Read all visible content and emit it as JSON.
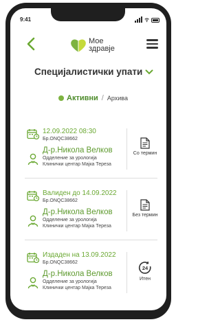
{
  "status_bar": {
    "time": "9:41"
  },
  "header": {
    "logo_line1": "Мое",
    "logo_line2": "здравје"
  },
  "page": {
    "title": "Специјалистички упати"
  },
  "filter": {
    "active": "Активни",
    "separator": "/",
    "archive": "Архива"
  },
  "referrals": [
    {
      "date": "12.09.2022  08:30",
      "number": "Бр.ONQC38662",
      "doctor": "Д-р.Никола Велков",
      "department": "Одделение за урологија",
      "clinic": "Клинички центар Мајка Тереза",
      "action": "Со термин",
      "action_icon": "document-calendar-icon"
    },
    {
      "date": "Валиден до 14.09.2022",
      "number": "Бр.ONQC38662",
      "doctor": "Д-р.Никола Велков",
      "department": "Одделение за урологија",
      "clinic": "Клинички центар Мајка Тереза",
      "action": "Без термин",
      "action_icon": "document-icon"
    },
    {
      "date": "Издаден на 13.09.2022",
      "number": "Бр.ONQC38662",
      "doctor": "Д-р.Никола Велков",
      "department": "Одделение за урологија",
      "clinic": "Клинички центар Мајка Тереза",
      "action": "Итен",
      "action_icon": "24h-icon"
    }
  ],
  "colors": {
    "accent_green": "#6aa832",
    "dark_green": "#4e8c2c",
    "text_dark": "#333333"
  }
}
